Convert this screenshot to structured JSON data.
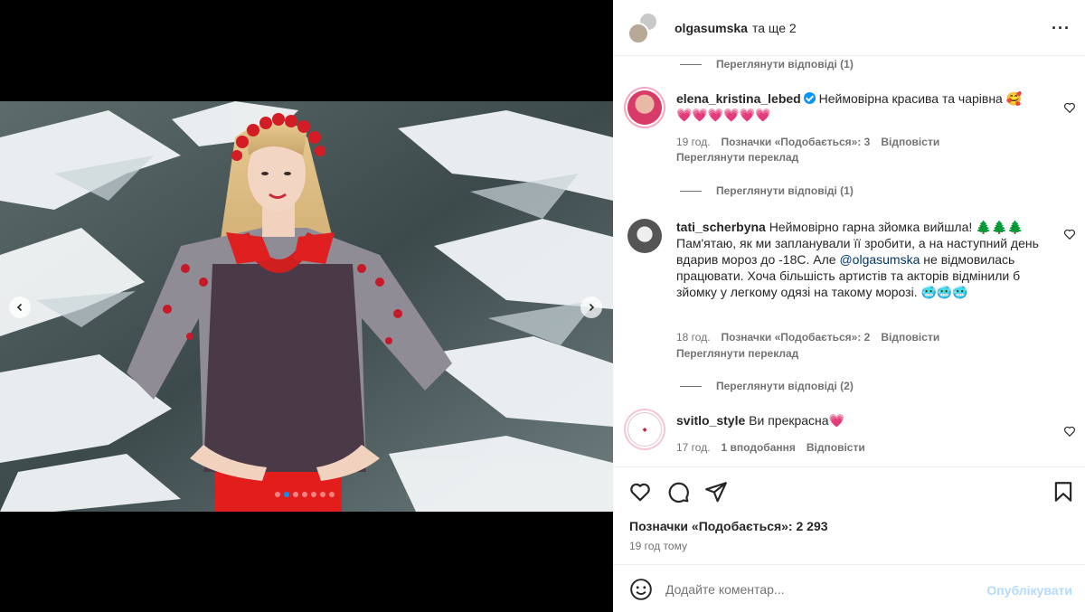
{
  "header": {
    "username": "olgasumska",
    "and_more": "та ще 2",
    "more_icon": "more-horizontal-icon"
  },
  "comments": {
    "view_replies_1": "Переглянути відповіді (1)",
    "items": [
      {
        "username": "elena_kristina_lebed",
        "verified": true,
        "text": "Неймовірна красива та чарівна 🥰",
        "text2": "💗💗💗💗💗💗",
        "time": "19 год.",
        "likes": "Позначки «Подобається»: 3",
        "reply": "Відповісти",
        "translate": "Переглянути переклад",
        "view_replies": "Переглянути відповіді (1)"
      },
      {
        "username": "tati_scherbyna",
        "text_a": "Неймовірно гарна зйомка вийшла! 🌲🌲🌲 Пам'ятаю, як ми запланували її зробити, а на наступний день вдарив мороз до -18С. Але",
        "mention": "@olgasumska",
        "text_b": "не відмовилась працювати. Хоча більшість артистів та акторів відмінили б зйомку у легкому одязі на такому морозі. 🥶🥶🥶",
        "time": "18 год.",
        "likes": "Позначки «Подобається»: 2",
        "reply": "Відповісти",
        "translate": "Переглянути переклад",
        "view_replies": "Переглянути відповіді (2)"
      },
      {
        "username": "svitlo_style",
        "text": "Ви прекрасна💗",
        "time": "17 год.",
        "likes": "1 вподобання",
        "reply": "Відповісти"
      }
    ]
  },
  "actions": {
    "likes_label": "Позначки «Подобається»: 2 293",
    "time_ago": "19 год тому"
  },
  "composer": {
    "placeholder": "Додайте коментар...",
    "post_label": "Опублікувати"
  },
  "carousel": {
    "total": 7,
    "active_index": 1
  },
  "colors": {
    "accent": "#0095f6",
    "post_disabled": "#b3dbff",
    "muted": "#737373"
  }
}
